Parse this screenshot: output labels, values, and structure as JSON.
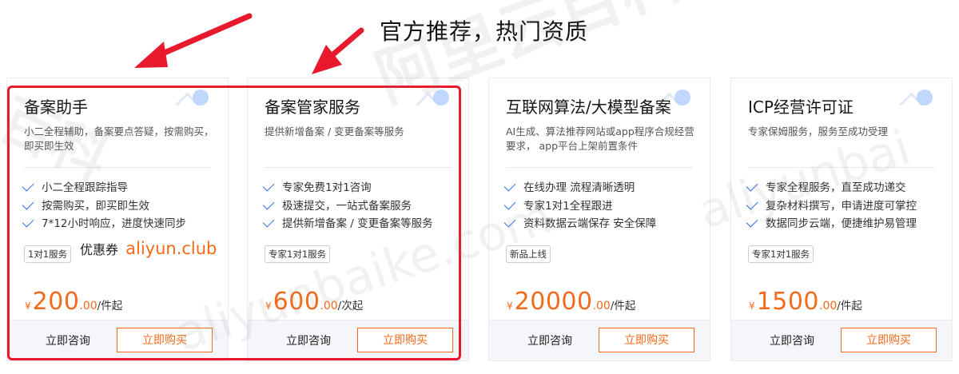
{
  "heading": "官方推荐，热门资质",
  "cards": [
    {
      "title": "备案助手",
      "description": "小二全程辅助，备案要点答疑，按需购买，即买即生效",
      "features": [
        "小二全程跟踪指导",
        "按需购买，即买即生效",
        "7*12小时响应，进度快速同步"
      ],
      "tag": "1对1服务",
      "promo_label": "优惠券",
      "promo_link": "aliyun.club",
      "currency": "¥",
      "price_int": "200",
      "price_dec": ".00",
      "unit": "/件起",
      "consult_label": "立即咨询",
      "buy_label": "立即购买"
    },
    {
      "title": "备案管家服务",
      "description": "提供新增备案 / 变更备案等服务",
      "features": [
        "专家免费1对1咨询",
        "极速提交，一站式备案服务",
        "提供新增备案 / 变更备案等服务"
      ],
      "tag": "专家1对1服务",
      "currency": "¥",
      "price_int": "600",
      "price_dec": ".00",
      "unit": "/次起",
      "consult_label": "立即咨询",
      "buy_label": "立即购买"
    },
    {
      "title": "互联网算法/大模型备案",
      "description": "AI生成、算法推荐网站或app程序合规经营要求， app平台上架前置条件",
      "features": [
        "在线办理 流程清晰透明",
        "专家1对1全程跟进",
        "资料数据云端保存 安全保障"
      ],
      "tag": "新品上线",
      "currency": "¥",
      "price_int": "20000",
      "price_dec": ".00",
      "unit": "/件起",
      "consult_label": "立即咨询",
      "buy_label": "立即购买"
    },
    {
      "title": "ICP经营许可证",
      "description": "专家保姆服务，服务至成功受理",
      "features": [
        "专家全程服务，直至成功递交",
        "复杂材料撰写，申请进度可掌控",
        "数据同步云端，便捷维护易管理"
      ],
      "tag": "专家1对1服务",
      "currency": "¥",
      "price_int": "1500",
      "price_dec": ".00",
      "unit": "/件起",
      "consult_label": "立即咨询",
      "buy_label": "立即购买"
    }
  ],
  "watermarks": [
    "阿里云百科",
    "百科",
    "aliyunbaike.com",
    "aliyunbai"
  ],
  "colors": {
    "accent": "#f56a1a",
    "check": "#2f6fe8",
    "highlight": "#e8192c"
  }
}
